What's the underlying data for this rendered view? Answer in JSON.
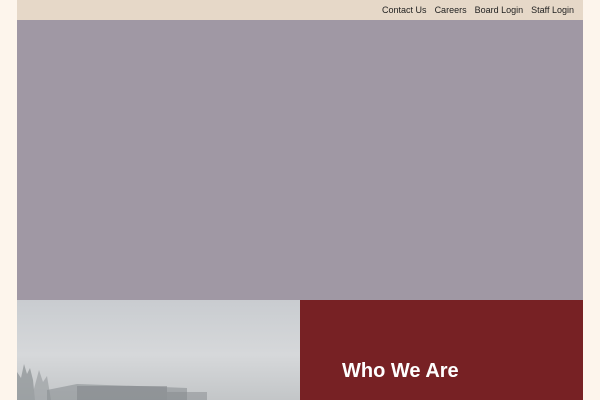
{
  "utility_nav": {
    "items": [
      {
        "label": "Contact Us"
      },
      {
        "label": "Careers"
      },
      {
        "label": "Board Login"
      },
      {
        "label": "Staff Login"
      }
    ]
  },
  "who_we_are": {
    "heading": "Who We Are"
  },
  "colors": {
    "page_background": "#fdf5ec",
    "topbar_background": "#e6d8c8",
    "hero_background": "#a098a4",
    "accent_maroon": "#772124"
  }
}
